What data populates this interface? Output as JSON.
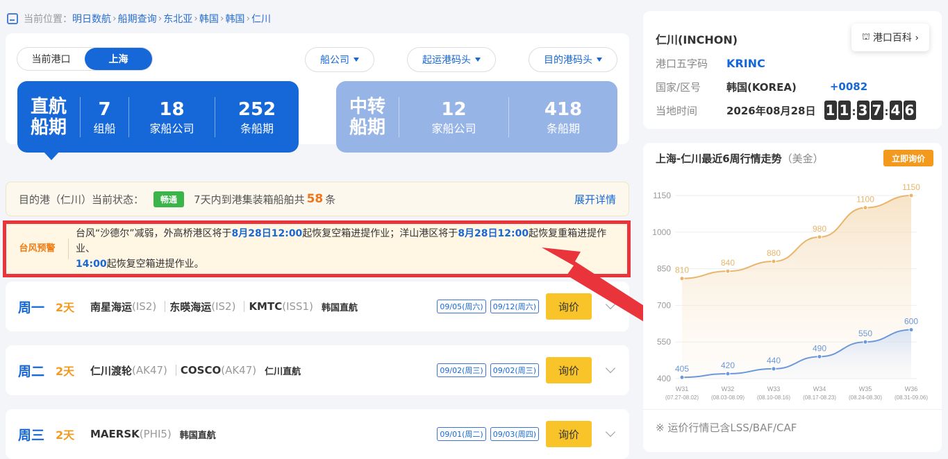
{
  "breadcrumb": {
    "prefix": "当前位置：",
    "items": [
      "明日数航",
      "船期查询",
      "东北亚",
      "韩国",
      "韩国",
      "仁川"
    ],
    "sep": ">"
  },
  "toggle": {
    "left": "当前港口",
    "right": "上海"
  },
  "filters": [
    "船公司",
    "起运港码头",
    "目的港码头"
  ],
  "direct": {
    "title": "直航\n船期",
    "groups": "7",
    "groups_label": "组船",
    "carriers": "18",
    "carriers_label": "家船公司",
    "schedules": "252",
    "schedules_label": "条船期"
  },
  "transfer": {
    "title": "中转\n船期",
    "carriers": "12",
    "carriers_label": "家船公司",
    "schedules": "418",
    "schedules_label": "条船期"
  },
  "status": {
    "label": "目的港（仁川）当前状态：",
    "badge": "畅通",
    "text": "7天内到港集装箱船舶共",
    "count": "58",
    "unit": "条",
    "link": "展开详情"
  },
  "warning": {
    "tag": "台风预警",
    "t1": "台风“沙德尔”减弱，外高桥港区将于",
    "d1": "8月28日12:00",
    "t2": "起恢复空箱进提作业；洋山港区将于",
    "d2": "8月28日12:00",
    "t3": "起恢复重箱进提作业、",
    "d3": "14:00",
    "t4": "起恢复空箱进提作业。"
  },
  "schedules": [
    {
      "weekday": "周一",
      "days": "2天",
      "carriers": [
        {
          "name": "南星海运",
          "code": "(IS2)"
        },
        {
          "name": "东暎海运",
          "code": "(IS2)"
        },
        {
          "name": "KMTC",
          "code": "(ISS1)"
        }
      ],
      "route": "韩国直航",
      "dates": [
        "09/05(周六)",
        "09/12(周六)"
      ],
      "btn": "询价"
    },
    {
      "weekday": "周二",
      "days": "2天",
      "carriers": [
        {
          "name": "仁川渡轮",
          "code": "(AK47)"
        },
        {
          "name": "COSCO",
          "code": "(AK47)"
        }
      ],
      "route": "仁川直航",
      "dates": [
        "09/02(周三)",
        "09/02(周三)"
      ],
      "btn": "询价"
    },
    {
      "weekday": "周三",
      "days": "2天",
      "carriers": [
        {
          "name": "MAERSK",
          "code": "(PHI5)"
        }
      ],
      "route": "韩国直航",
      "dates": [
        "09/01(周二)",
        "09/03(周四)"
      ],
      "btn": "询价"
    }
  ],
  "port": {
    "name": "仁川(INCHON)",
    "wiki": "港口百科 ›",
    "code_label": "港口五字码",
    "code": "KRINC",
    "country_label": "国家/区号",
    "country": "韩国(KOREA)",
    "dial": "+0082",
    "time_label": "当地时间",
    "date": "2026年08月28日",
    "time": "11:37:46"
  },
  "chart": {
    "title": "上海-仁川最近6周行情走势",
    "unit": "（美金）",
    "btn": "立即询价",
    "note": "※ 运价行情已含LSS/BAF/CAF"
  },
  "chart_data": {
    "type": "line",
    "categories": [
      "W31",
      "W32",
      "W33",
      "W34",
      "W35",
      "W36"
    ],
    "x_sub": [
      "(07.27-08.02)",
      "(08.03-08.09)",
      "(08.10-08.16)",
      "(08.17-08.23)",
      "(08.24-08.30)",
      "(08.31-09.06)"
    ],
    "series": [
      {
        "color": "#e8b56a",
        "values": [
          810,
          840,
          880,
          980,
          1100,
          1150
        ]
      },
      {
        "color": "#6b98d8",
        "values": [
          405,
          420,
          440,
          490,
          550,
          600
        ]
      }
    ],
    "yticks": [
      400,
      550,
      700,
      850,
      1000,
      1150
    ],
    "ylim": [
      400,
      1150
    ],
    "grid": true
  }
}
